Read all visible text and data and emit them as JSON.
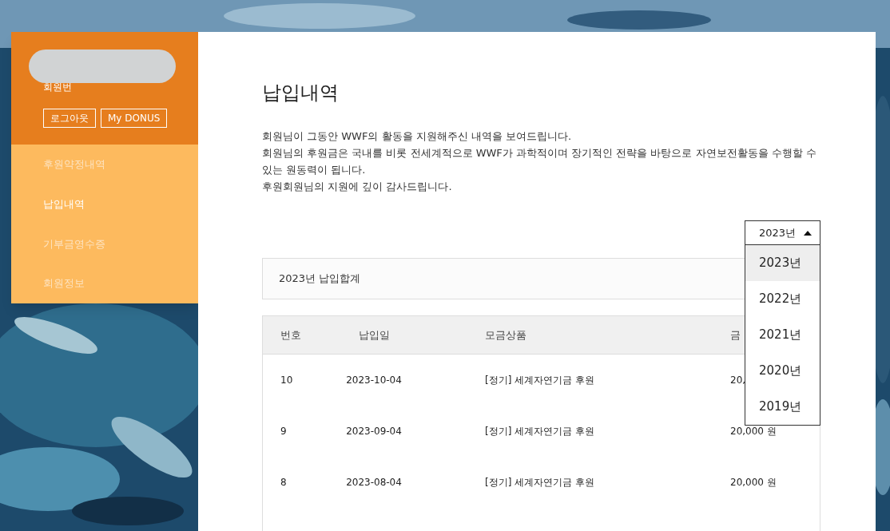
{
  "sidebar": {
    "member_label": "회원번",
    "buttons": [
      "로그아웃",
      "My DONUS"
    ],
    "items": [
      {
        "label": "후원약정내역",
        "selected": false
      },
      {
        "label": "납입내역",
        "selected": true
      },
      {
        "label": "기부금영수증",
        "selected": false
      },
      {
        "label": "회원정보",
        "selected": false
      }
    ]
  },
  "page": {
    "title": "납입내역",
    "intro": [
      "회원님이 그동안 WWF의 활동을 지원해주신 내역을 보여드립니다.",
      "회원님의 후원금은 국내를 비롯 전세계적으로 WWF가 과학적이며 장기적인 전략을 바탕으로 자연보전활동을 수행할 수 있는 원동력이 됩니다.",
      "후원회원님의 지원에 깊이 감사드립니다."
    ]
  },
  "year_select": {
    "value": "2023년",
    "expanded": true,
    "options": [
      {
        "label": "2023년",
        "selected": true
      },
      {
        "label": "2022년",
        "selected": false
      },
      {
        "label": "2021년",
        "selected": false
      },
      {
        "label": "2020년",
        "selected": false
      },
      {
        "label": "2019년",
        "selected": false
      }
    ]
  },
  "summary": {
    "label": "2023년 납입합계"
  },
  "table": {
    "columns": [
      "번호",
      "납입일",
      "모금상품",
      "금"
    ],
    "rows": [
      [
        "10",
        "2023-10-04",
        "[정기] 세계자연기금 후원",
        "20,"
      ],
      [
        "9",
        "2023-09-04",
        "[정기] 세계자연기금 후원",
        "20,000 원"
      ],
      [
        "8",
        "2023-08-04",
        "[정기] 세계자연기금 후원",
        "20,000 원"
      ]
    ]
  }
}
